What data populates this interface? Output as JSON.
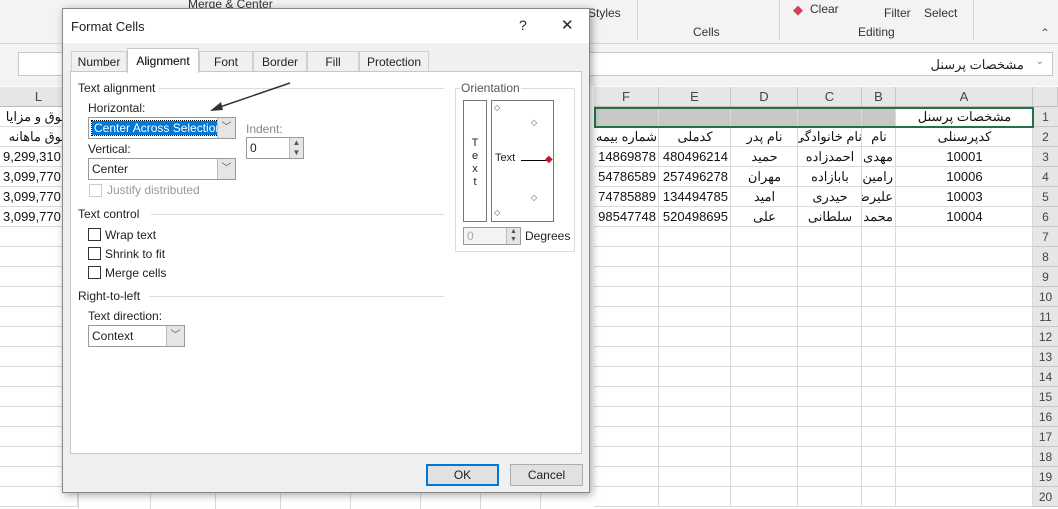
{
  "ribbon": {
    "merge_center": "Merge & Center",
    "styles": "Styles",
    "clear": "Clear",
    "filter": "Filter",
    "select": "Select",
    "cells_group": "Cells",
    "editing_group": "Editing"
  },
  "formula_bar": {
    "value": "مشخصات پرسنل"
  },
  "sheet": {
    "columns": [
      "L",
      "F",
      "E",
      "D",
      "C",
      "B",
      "A"
    ],
    "row_numbers": [
      "1",
      "2",
      "3",
      "4",
      "5",
      "6",
      "7",
      "8",
      "9",
      "10",
      "11",
      "12",
      "13",
      "14",
      "15",
      "16",
      "17",
      "18",
      "19",
      "20"
    ],
    "title_cell": "مشخصات پرسنل",
    "headers": {
      "A": "کدپرسنلی",
      "B": "نام",
      "C": "نام خانوادگی",
      "D": "نام پدر",
      "E": "کدملی",
      "F": "شماره بیمه",
      "L1": "حقوق و مزایا",
      "L2": "حقوق ماهانه"
    },
    "rows": [
      {
        "A": "10001",
        "B": "مهدی",
        "C": "احمدزاده",
        "D": "حمید",
        "E": "480496214",
        "F": "14869878",
        "L": "9,299,310"
      },
      {
        "A": "10006",
        "B": "رامین",
        "C": "بابازاده",
        "D": "مهران",
        "E": "257496278",
        "F": "54786589",
        "L": "3,099,770"
      },
      {
        "A": "10003",
        "B": "علیرضا",
        "C": "حیدری",
        "D": "امید",
        "E": "134494785",
        "F": "74785889",
        "L": "3,099,770"
      },
      {
        "A": "10004",
        "B": "محمد",
        "C": "سلطانی",
        "D": "علی",
        "E": "520498695",
        "F": "98547748",
        "L": "3,099,770"
      }
    ],
    "selection_border_color": "#217346"
  },
  "dialog": {
    "title": "Format Cells",
    "help": "?",
    "close": "✕",
    "tabs": [
      "Number",
      "Alignment",
      "Font",
      "Border",
      "Fill",
      "Protection"
    ],
    "active_tab": "Alignment",
    "text_alignment": "Text alignment",
    "horizontal_label": "Horizontal:",
    "horizontal_value": "Center Across Selection",
    "indent_label": "Indent:",
    "indent_value": "0",
    "vertical_label": "Vertical:",
    "vertical_value": "Center",
    "justify_distributed": "Justify distributed",
    "text_control": "Text control",
    "wrap_text": "Wrap text",
    "shrink_to_fit": "Shrink to fit",
    "merge_cells": "Merge cells",
    "rtl": "Right-to-left",
    "text_direction_label": "Text direction:",
    "text_direction_value": "Context",
    "orientation": "Orientation",
    "orientation_text": "Text",
    "vertical_text": "T e x t",
    "degrees_value": "0",
    "degrees_label": "Degrees",
    "ok": "OK",
    "cancel": "Cancel"
  }
}
